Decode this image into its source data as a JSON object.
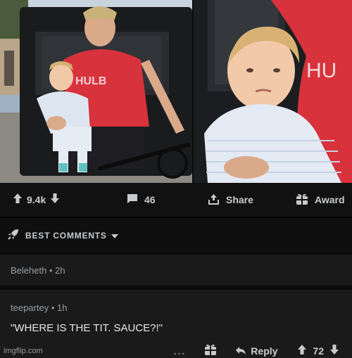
{
  "post": {
    "vote_count": "9.4k",
    "comment_count": "46",
    "share_label": "Share",
    "award_label": "Award"
  },
  "comments_header": {
    "sort_label": "BEST COMMENTS"
  },
  "comments": [
    {
      "author": "Beleheth",
      "age": "2h"
    },
    {
      "author": "teepartey",
      "age": "1h",
      "body": "\"WHERE IS THE TIT. SAUCE?!\"",
      "more": "...",
      "reply_label": "Reply",
      "vote_count": "72"
    }
  ],
  "photo": {
    "jersey_text": "HULB",
    "jersey_text_closeup": "HU"
  },
  "watermark": "imgflip.com",
  "colors": {
    "background": "#0b0b0b",
    "bar": "#111111",
    "comment_bg": "#1a1a1b",
    "jersey_red": "#d8323c"
  },
  "icons": {
    "upvote": "arrow-up-icon",
    "downvote": "arrow-down-icon",
    "comments": "comment-bubble-icon",
    "share": "share-icon",
    "award": "gift-icon",
    "sort": "rocket-icon",
    "reply": "reply-arrow-icon"
  }
}
